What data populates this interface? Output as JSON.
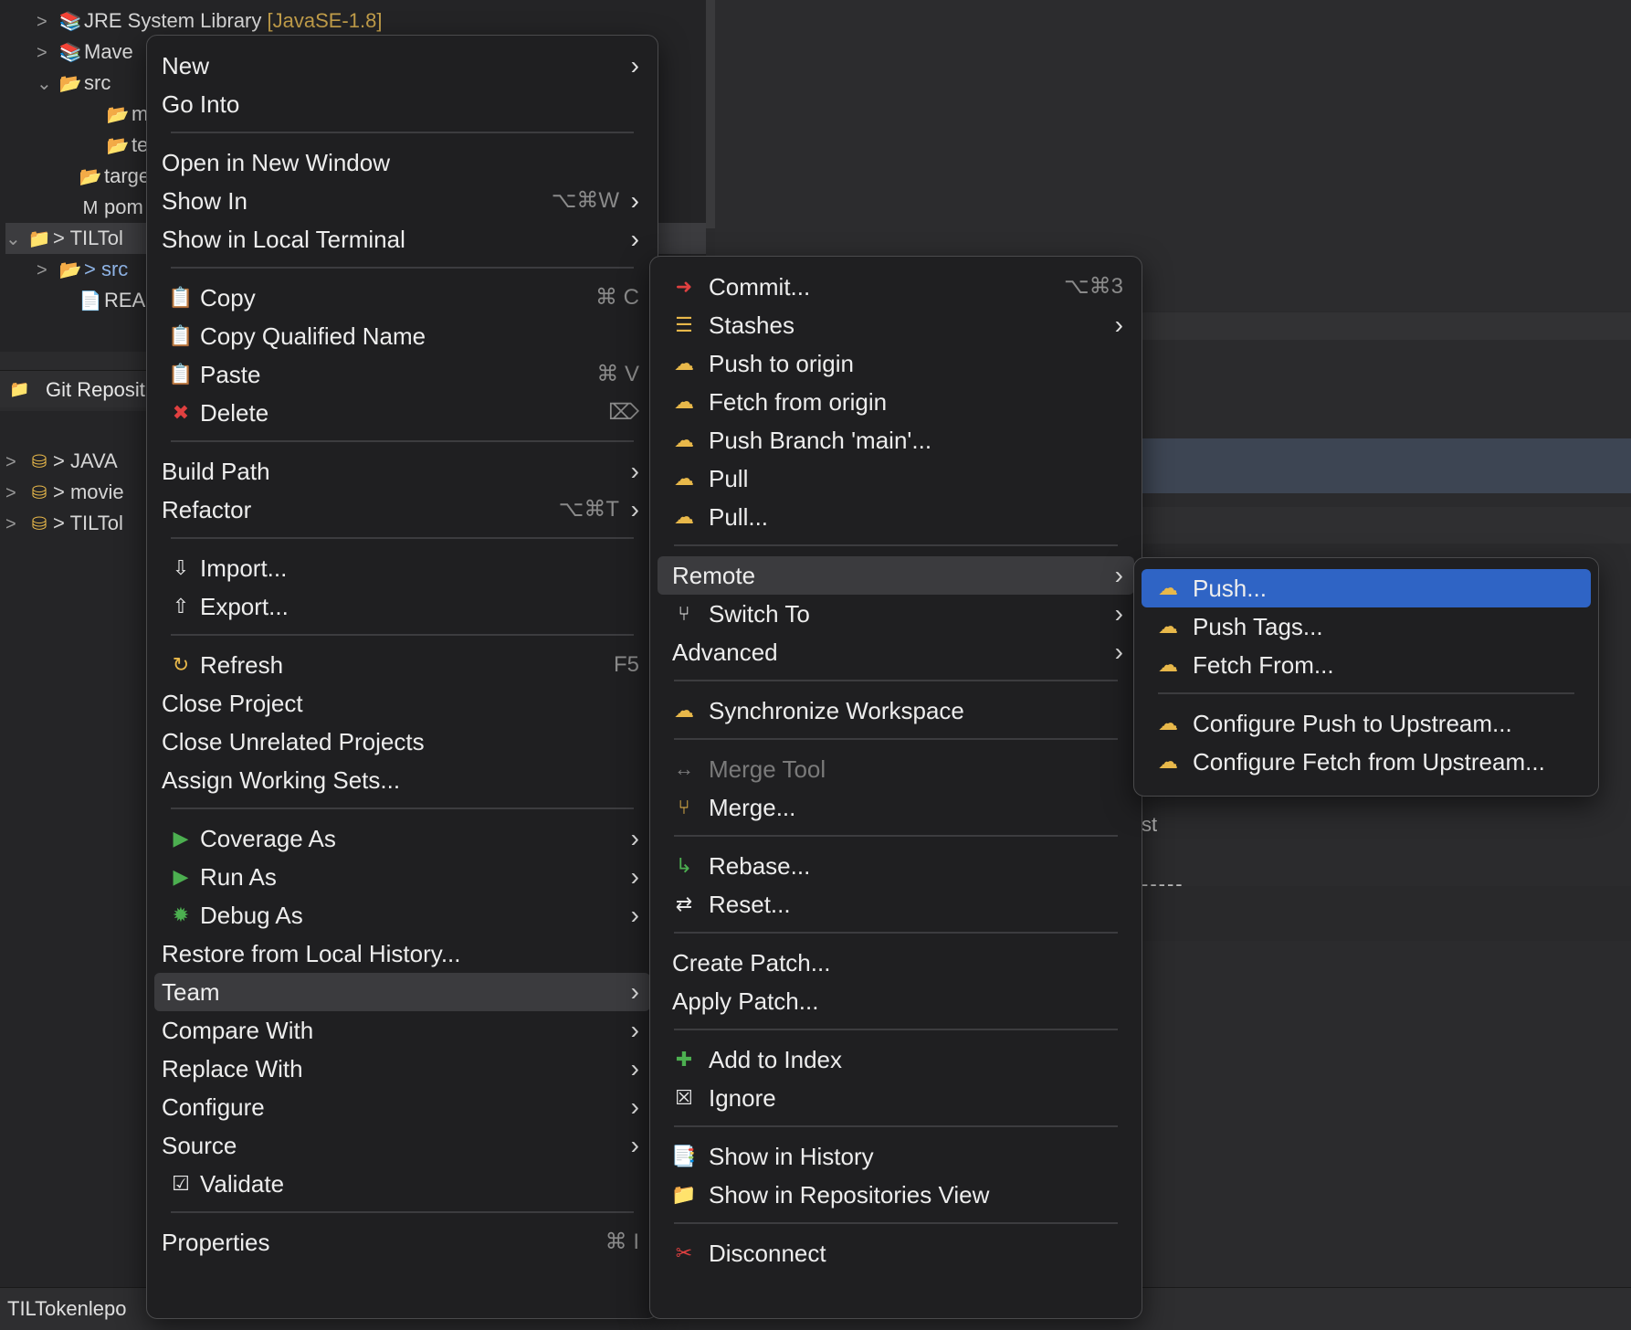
{
  "explorer": {
    "rows": [
      {
        "chev": ">",
        "icon": "library-icon",
        "glyph": "📚",
        "text": "JRE System Library ",
        "extra": "[JavaSE-1.8]",
        "indent": 40
      },
      {
        "chev": ">",
        "icon": "library-icon",
        "glyph": "📚",
        "text": "Mave",
        "extra": "",
        "indent": 40
      },
      {
        "chev": "⌄",
        "icon": "folder-open-icon",
        "glyph": "📂",
        "text": "src",
        "extra": "",
        "indent": 40
      },
      {
        "chev": "",
        "icon": "folder-icon",
        "glyph": "📂",
        "text": "m",
        "extra": "",
        "indent": 92
      },
      {
        "chev": "",
        "icon": "folder-icon",
        "glyph": "📂",
        "text": "te",
        "extra": "",
        "indent": 92
      },
      {
        "chev": "",
        "icon": "folder-icon",
        "glyph": "📂",
        "text": "targe",
        "extra": "",
        "indent": 62
      },
      {
        "chev": "",
        "icon": "maven-file-icon",
        "glyph": "M",
        "text": "pom",
        "extra": "",
        "indent": 62
      },
      {
        "chev": "⌄",
        "icon": "project-icon",
        "glyph": "📁",
        "text": "> TILTol",
        "extra": "",
        "indent": 6
      },
      {
        "chev": ">",
        "icon": "folder-icon",
        "glyph": "📂",
        "text": "",
        "extra": "> src",
        "indent": 40
      },
      {
        "chev": "",
        "icon": "readme-icon",
        "glyph": "📄",
        "text": "REAI",
        "extra": "",
        "indent": 62
      }
    ]
  },
  "git_repos": {
    "title": "Git Reposit",
    "rows": [
      {
        "text": "> JAVA"
      },
      {
        "text": "> movie"
      },
      {
        "text": "> TILTol"
      }
    ]
  },
  "status_bar": {
    "text": "TILTokenlepo"
  },
  "fragments": {
    "st": "st",
    "dashes": "-----"
  },
  "context_menu": {
    "items": [
      {
        "label": "New",
        "arrow": true
      },
      {
        "label": "Go Into"
      },
      {
        "sep": true
      },
      {
        "label": "Open in New Window"
      },
      {
        "label": "Show In",
        "shortcut": "⌥⌘W",
        "arrow": true
      },
      {
        "label": "Show in Local Terminal",
        "arrow": true
      },
      {
        "sep": true
      },
      {
        "label": "Copy",
        "icon": "copy-icon",
        "glyph": "📋",
        "shortcut": "⌘ C"
      },
      {
        "label": "Copy Qualified Name",
        "icon": "copy-qualified-icon",
        "glyph": "📋"
      },
      {
        "label": "Paste",
        "icon": "paste-icon",
        "glyph": "📋",
        "shortcut": "⌘ V"
      },
      {
        "label": "Delete",
        "icon": "delete-icon",
        "glyph": "✖",
        "glyphClass": "red",
        "shortcut": "⌦"
      },
      {
        "sep": true
      },
      {
        "label": "Build Path",
        "arrow": true
      },
      {
        "label": "Refactor",
        "shortcut": "⌥⌘T",
        "arrow": true
      },
      {
        "sep": true
      },
      {
        "label": "Import...",
        "icon": "import-icon",
        "glyph": "⇩"
      },
      {
        "label": "Export...",
        "icon": "export-icon",
        "glyph": "⇧"
      },
      {
        "sep": true
      },
      {
        "label": "Refresh",
        "icon": "refresh-icon",
        "glyph": "↻",
        "glyphClass": "gold",
        "shortcut": "F5"
      },
      {
        "label": "Close Project"
      },
      {
        "label": "Close Unrelated Projects"
      },
      {
        "label": "Assign Working Sets..."
      },
      {
        "sep": true
      },
      {
        "label": "Coverage As",
        "icon": "coverage-icon",
        "glyph": "▶",
        "glyphClass": "green",
        "arrow": true
      },
      {
        "label": "Run As",
        "icon": "run-icon",
        "glyph": "▶",
        "glyphClass": "green",
        "arrow": true
      },
      {
        "label": "Debug As",
        "icon": "debug-icon",
        "glyph": "✹",
        "glyphClass": "green",
        "arrow": true
      },
      {
        "label": "Restore from Local History..."
      },
      {
        "label": "Team",
        "arrow": true,
        "highlight": true
      },
      {
        "label": "Compare With",
        "arrow": true
      },
      {
        "label": "Replace With",
        "arrow": true
      },
      {
        "label": "Configure",
        "arrow": true
      },
      {
        "label": "Source",
        "arrow": true
      },
      {
        "label": "Validate",
        "icon": "checkbox-icon",
        "glyph": "☑"
      },
      {
        "sep": true
      },
      {
        "label": "Properties",
        "shortcut": "⌘ I"
      }
    ]
  },
  "team_menu": {
    "items": [
      {
        "label": "Commit...",
        "icon": "commit-icon",
        "glyph": "➜",
        "glyphClass": "red",
        "shortcut": "⌥⌘3"
      },
      {
        "label": "Stashes",
        "icon": "stashes-icon",
        "glyph": "☰",
        "glyphClass": "gold",
        "arrow": true
      },
      {
        "label": "Push to origin",
        "icon": "push-cloud-icon",
        "glyph": "☁",
        "glyphClass": "gold"
      },
      {
        "label": "Fetch from origin",
        "icon": "fetch-cloud-icon",
        "glyph": "☁",
        "glyphClass": "gold"
      },
      {
        "label": "Push Branch 'main'...",
        "icon": "push-branch-icon",
        "glyph": "☁",
        "glyphClass": "gold"
      },
      {
        "label": "Pull",
        "icon": "pull-icon",
        "glyph": "☁",
        "glyphClass": "gold"
      },
      {
        "label": "Pull...",
        "icon": "pull-dialog-icon",
        "glyph": "☁",
        "glyphClass": "gold"
      },
      {
        "sep": true
      },
      {
        "label": "Remote",
        "arrow": true,
        "highlight": true
      },
      {
        "label": "Switch To",
        "icon": "switch-branch-icon",
        "glyph": "⑂",
        "arrow": true
      },
      {
        "label": "Advanced",
        "arrow": true
      },
      {
        "sep": true
      },
      {
        "label": "Synchronize Workspace",
        "icon": "synchronize-icon",
        "glyph": "☁",
        "glyphClass": "gold"
      },
      {
        "sep": true
      },
      {
        "label": "Merge Tool",
        "icon": "merge-tool-icon",
        "glyph": "↔",
        "disabled": true
      },
      {
        "label": "Merge...",
        "icon": "merge-icon",
        "glyph": "⑂",
        "glyphClass": "gold"
      },
      {
        "sep": true
      },
      {
        "label": "Rebase...",
        "icon": "rebase-icon",
        "glyph": "↳",
        "glyphClass": "green"
      },
      {
        "label": "Reset...",
        "icon": "reset-icon",
        "glyph": "⇄"
      },
      {
        "sep": true
      },
      {
        "label": "Create Patch..."
      },
      {
        "label": "Apply Patch..."
      },
      {
        "sep": true
      },
      {
        "label": "Add to Index",
        "icon": "add-icon",
        "glyph": "✚",
        "glyphClass": "green"
      },
      {
        "label": "Ignore",
        "icon": "ignore-icon",
        "glyph": "☒"
      },
      {
        "sep": true
      },
      {
        "label": "Show in History",
        "icon": "history-icon",
        "glyph": "📑"
      },
      {
        "label": "Show in Repositories View",
        "icon": "git-repo-icon",
        "glyph": "📁",
        "glyphClass": "gold"
      },
      {
        "sep": true
      },
      {
        "label": "Disconnect",
        "icon": "disconnect-icon",
        "glyph": "✂",
        "glyphClass": "red"
      }
    ]
  },
  "remote_menu": {
    "items": [
      {
        "label": "Push...",
        "icon": "push-cloud-icon",
        "glyph": "☁",
        "glyphClass": "gold",
        "active": true
      },
      {
        "label": "Push Tags...",
        "icon": "push-tags-icon",
        "glyph": "☁",
        "glyphClass": "gold"
      },
      {
        "label": "Fetch From...",
        "icon": "fetch-from-icon",
        "glyph": "☁",
        "glyphClass": "gold"
      },
      {
        "sep": true
      },
      {
        "label": "Configure Push to Upstream...",
        "icon": "configure-push-icon",
        "glyph": "☁",
        "glyphClass": "gold"
      },
      {
        "label": "Configure Fetch from Upstream...",
        "icon": "configure-fetch-icon",
        "glyph": "☁",
        "glyphClass": "gold"
      }
    ]
  }
}
